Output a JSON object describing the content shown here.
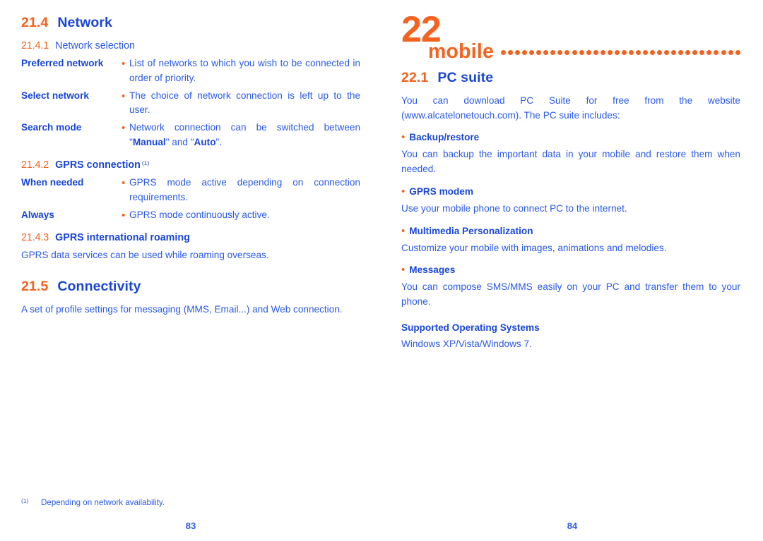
{
  "document": {
    "type": "user-manual-spread",
    "colors": {
      "orange": "#F4621F",
      "heading_blue": "#1A46D8",
      "body_blue": "#2B5AE8",
      "background": "#FFFFFF"
    }
  },
  "left_page": {
    "folio": "83",
    "section_network": {
      "number": "21.4",
      "title": "Network"
    },
    "subsection_network_selection": {
      "number": "21.4.1",
      "title": "Network selection"
    },
    "network_selection_items": [
      {
        "term": "Preferred network",
        "bullet": "•",
        "description": "List of networks to which you wish to be connected in order of priority."
      },
      {
        "term": "Select network",
        "bullet": "•",
        "description": "The choice of network connection is left up to the user."
      },
      {
        "term": "Search mode",
        "bullet": "•",
        "description_parts": [
          {
            "text": "Network connection can be switched between \"",
            "bold": false
          },
          {
            "text": "Manual",
            "bold": true
          },
          {
            "text": "\" and \"",
            "bold": false
          },
          {
            "text": "Auto",
            "bold": true
          },
          {
            "text": "\".",
            "bold": false
          }
        ]
      }
    ],
    "subsection_gprs_connection": {
      "number": "21.4.2",
      "title": "GPRS connection",
      "footnote_marker": "(1)"
    },
    "gprs_connection_items": [
      {
        "term": "When needed",
        "bullet": "•",
        "description": "GPRS mode active depending on connection requirements."
      },
      {
        "term": "Always",
        "bullet": "•",
        "description": "GPRS mode continuously active."
      }
    ],
    "subsection_gprs_roaming": {
      "number": "21.4.3",
      "title": "GPRS international roaming",
      "body": "GPRS data services can be used while roaming overseas."
    },
    "section_connectivity": {
      "number": "21.5",
      "title": "Connectivity",
      "body": "A set of profile settings for messaging (MMS, Email...) and Web connection."
    },
    "footnote": {
      "marker": "(1)",
      "text": "Depending on network availability."
    }
  },
  "right_page": {
    "folio": "84",
    "chapter": {
      "number": "22",
      "title": "mobile",
      "leader_dot_count": 34
    },
    "section_pc_suite": {
      "number": "22.1",
      "title": "PC suite",
      "intro": "You can download PC Suite for free from the website (www.alcatelonetouch.com). The PC suite includes:"
    },
    "features": [
      {
        "bullet": "•",
        "heading": "Backup/restore",
        "body": "You can backup the important data in your mobile and restore them when needed."
      },
      {
        "bullet": "•",
        "heading": "GPRS modem",
        "body": "Use your mobile phone to connect PC to the internet."
      },
      {
        "bullet": "•",
        "heading": "Multimedia Personalization",
        "body": "Customize your mobile with images, animations and melodies."
      },
      {
        "bullet": "•",
        "heading": "Messages",
        "body": "You can compose SMS/MMS easily on your PC and transfer them to your phone."
      }
    ],
    "supported_os": {
      "heading": "Supported Operating Systems",
      "body": "Windows XP/Vista/Windows 7."
    }
  }
}
